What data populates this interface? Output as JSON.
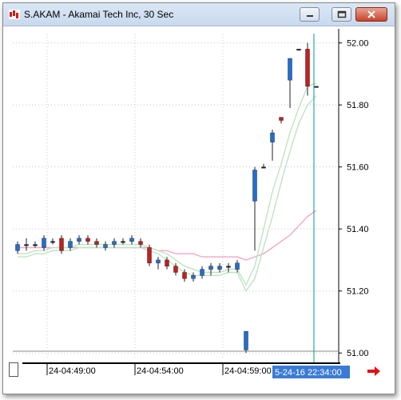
{
  "window": {
    "title": "S.AKAM - Akamai Tech Inc, 30 Sec"
  },
  "colors": {
    "up": "#1f6fd1",
    "down": "#c41e1e",
    "neutral": "#222222",
    "ma_fast": "#bfe3c3",
    "ma_slow": "#f2a7c8",
    "cursor": "#009a9a",
    "highlight": "#3a7bd5"
  },
  "icons": [
    "app-icon",
    "minimize-icon",
    "maximize-icon",
    "close-icon",
    "scroll-right-arrow-icon"
  ],
  "chart_data": {
    "type": "candlestick",
    "y_ticks": [
      "52.00",
      "51.80",
      "51.60",
      "51.40",
      "51.20",
      "51.00"
    ],
    "ylim": [
      50.98,
      52.03
    ],
    "x_labels": [
      "24-04:49:00",
      "24-04:54:00",
      "24-04:59:00"
    ],
    "x_label_index": [
      4,
      14,
      24
    ],
    "cursor_label": "5-24-16 22:34:00",
    "cursor_index": 34,
    "candles": [
      {
        "o": 51.33,
        "h": 51.36,
        "l": 51.32,
        "c": 51.35
      },
      {
        "o": 51.35,
        "h": 51.37,
        "l": 51.33,
        "c": 51.35
      },
      {
        "o": 51.35,
        "h": 51.36,
        "l": 51.34,
        "c": 51.35
      },
      {
        "o": 51.34,
        "h": 51.38,
        "l": 51.33,
        "c": 51.37
      },
      {
        "o": 51.36,
        "h": 51.37,
        "l": 51.35,
        "c": 51.36
      },
      {
        "o": 51.37,
        "h": 51.38,
        "l": 51.32,
        "c": 51.33
      },
      {
        "o": 51.34,
        "h": 51.37,
        "l": 51.33,
        "c": 51.36
      },
      {
        "o": 51.36,
        "h": 51.38,
        "l": 51.35,
        "c": 51.37
      },
      {
        "o": 51.37,
        "h": 51.38,
        "l": 51.35,
        "c": 51.36
      },
      {
        "o": 51.36,
        "h": 51.37,
        "l": 51.34,
        "c": 51.35
      },
      {
        "o": 51.34,
        "h": 51.36,
        "l": 51.33,
        "c": 51.35
      },
      {
        "o": 51.35,
        "h": 51.37,
        "l": 51.34,
        "c": 51.36
      },
      {
        "o": 51.36,
        "h": 51.37,
        "l": 51.35,
        "c": 51.36
      },
      {
        "o": 51.36,
        "h": 51.38,
        "l": 51.35,
        "c": 51.37
      },
      {
        "o": 51.36,
        "h": 51.37,
        "l": 51.34,
        "c": 51.35
      },
      {
        "o": 51.34,
        "h": 51.35,
        "l": 51.28,
        "c": 51.29
      },
      {
        "o": 51.29,
        "h": 51.31,
        "l": 51.27,
        "c": 51.3
      },
      {
        "o": 51.3,
        "h": 51.31,
        "l": 51.27,
        "c": 51.28
      },
      {
        "o": 51.28,
        "h": 51.29,
        "l": 51.25,
        "c": 51.26
      },
      {
        "o": 51.26,
        "h": 51.27,
        "l": 51.23,
        "c": 51.24
      },
      {
        "o": 51.24,
        "h": 51.26,
        "l": 51.23,
        "c": 51.25
      },
      {
        "o": 51.25,
        "h": 51.28,
        "l": 51.24,
        "c": 51.27
      },
      {
        "o": 51.27,
        "h": 51.29,
        "l": 51.25,
        "c": 51.28
      },
      {
        "o": 51.27,
        "h": 51.29,
        "l": 51.26,
        "c": 51.28
      },
      {
        "o": 51.28,
        "h": 51.29,
        "l": 51.26,
        "c": 51.28
      },
      {
        "o": 51.27,
        "h": 51.3,
        "l": 51.26,
        "c": 51.29
      },
      {
        "o": 51.01,
        "h": 51.07,
        "l": 51.0,
        "c": 51.07
      },
      {
        "o": 51.49,
        "h": 51.6,
        "l": 51.33,
        "c": 51.59
      },
      {
        "o": 51.6,
        "h": 51.61,
        "l": 51.6,
        "c": 51.6
      },
      {
        "o": 51.68,
        "h": 51.72,
        "l": 51.62,
        "c": 51.71
      },
      {
        "o": 51.76,
        "h": 51.76,
        "l": 51.74,
        "c": 51.75
      },
      {
        "o": 51.88,
        "h": 51.95,
        "l": 51.79,
        "c": 51.95
      },
      {
        "o": 51.98,
        "h": 51.98,
        "l": 51.98,
        "c": 51.98
      },
      {
        "o": 51.98,
        "h": 52.0,
        "l": 51.83,
        "c": 51.86
      },
      {
        "o": 51.86,
        "h": 51.86,
        "l": 51.86,
        "c": 51.86
      }
    ],
    "ma_fast": [
      51.32,
      51.32,
      51.33,
      51.33,
      51.34,
      51.34,
      51.34,
      51.35,
      51.35,
      51.35,
      51.35,
      51.35,
      51.35,
      51.35,
      51.35,
      51.34,
      51.33,
      51.32,
      51.3,
      51.28,
      51.27,
      51.26,
      51.26,
      51.26,
      51.27,
      51.27,
      51.22,
      51.28,
      51.4,
      51.52,
      51.61,
      51.71,
      51.79,
      51.86,
      51.87
    ],
    "ma_fast2": [
      51.31,
      51.31,
      51.32,
      51.32,
      51.33,
      51.33,
      51.33,
      51.34,
      51.34,
      51.34,
      51.34,
      51.34,
      51.34,
      51.34,
      51.34,
      51.33,
      51.32,
      51.3,
      51.28,
      51.26,
      51.25,
      51.25,
      51.25,
      51.25,
      51.26,
      51.26,
      51.2,
      51.24,
      51.34,
      51.44,
      51.55,
      51.65,
      51.74,
      51.8,
      51.83
    ],
    "ma_slow": [
      51.34,
      51.34,
      51.34,
      51.34,
      51.34,
      51.34,
      51.34,
      51.34,
      51.34,
      51.34,
      51.34,
      51.34,
      51.34,
      51.34,
      51.34,
      51.34,
      51.33,
      51.33,
      51.32,
      51.32,
      51.32,
      51.31,
      51.31,
      51.31,
      51.31,
      51.31,
      51.3,
      51.31,
      51.32,
      51.34,
      51.36,
      51.38,
      51.41,
      51.44,
      51.46
    ]
  }
}
